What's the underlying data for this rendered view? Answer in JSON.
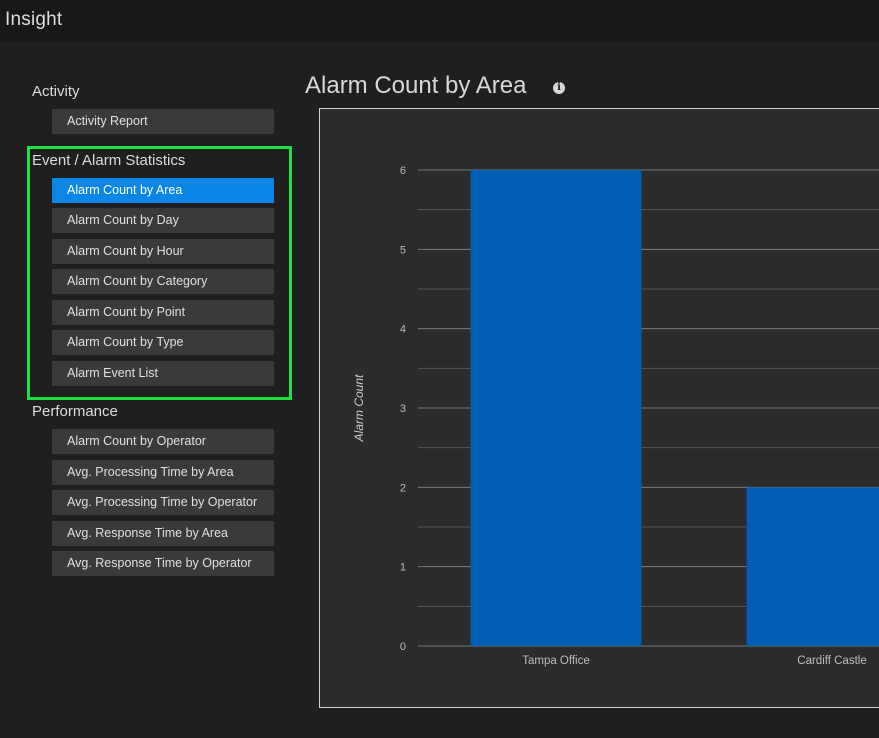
{
  "app": {
    "title": "Insight"
  },
  "sidebar": {
    "sections": [
      {
        "heading": "Activity",
        "items": [
          "Activity Report"
        ]
      },
      {
        "heading": "Event / Alarm Statistics",
        "items": [
          "Alarm Count by Area",
          "Alarm Count by Day",
          "Alarm Count by Hour",
          "Alarm Count by Category",
          "Alarm Count by Point",
          "Alarm Count by Type",
          "Alarm Event List"
        ]
      },
      {
        "heading": "Performance",
        "items": [
          "Alarm Count by Operator",
          "Avg. Processing Time by Area",
          "Avg. Processing Time by Operator",
          "Avg. Response Time by Area",
          "Avg. Response Time by Operator"
        ]
      }
    ],
    "active_item": "Alarm Count by Area"
  },
  "main": {
    "title": "Alarm Count by Area",
    "info_icon": "info-icon"
  },
  "colors": {
    "accent": "#0a86e6",
    "bar": "#005eb3",
    "highlight": "#1ee040"
  },
  "chart_data": {
    "type": "bar",
    "title": "Alarm Count by Area",
    "xlabel": "",
    "ylabel": "Alarm Count",
    "categories": [
      "Tampa Office",
      "Cardiff Castle"
    ],
    "values": [
      6,
      2
    ],
    "ylim": [
      0,
      6
    ],
    "yticks": [
      "0",
      "1",
      "2",
      "3",
      "4",
      "5",
      "6"
    ],
    "grid": true
  }
}
